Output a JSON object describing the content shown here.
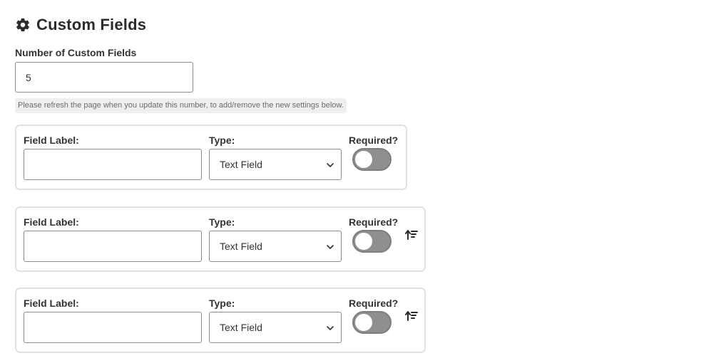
{
  "header": {
    "title": "Custom Fields",
    "icon": "gear-icon"
  },
  "count": {
    "label": "Number of Custom Fields",
    "value": "5",
    "hint": "Please refresh the page when you update this number, to add/remove the new settings below."
  },
  "fields": [
    {
      "label_text": "Field Label:",
      "label_value": "",
      "type_label": "Type:",
      "type_value": "Text Field",
      "required_label": "Required?",
      "required": false,
      "sort_icon": null
    },
    {
      "label_text": "Field Label:",
      "label_value": "",
      "type_label": "Type:",
      "type_value": "Text Field",
      "required_label": "Required?",
      "required": false,
      "sort_icon": "sort-ascending-icon"
    },
    {
      "label_text": "Field Label:",
      "label_value": "",
      "type_label": "Type:",
      "type_value": "Text Field",
      "required_label": "Required?",
      "required": false,
      "sort_icon": "sort-ascending-icon"
    }
  ],
  "colors": {
    "toggle_off": "#8f8f8f",
    "card_border": "#e1e1e1",
    "hint_bg": "#eef0ef"
  }
}
